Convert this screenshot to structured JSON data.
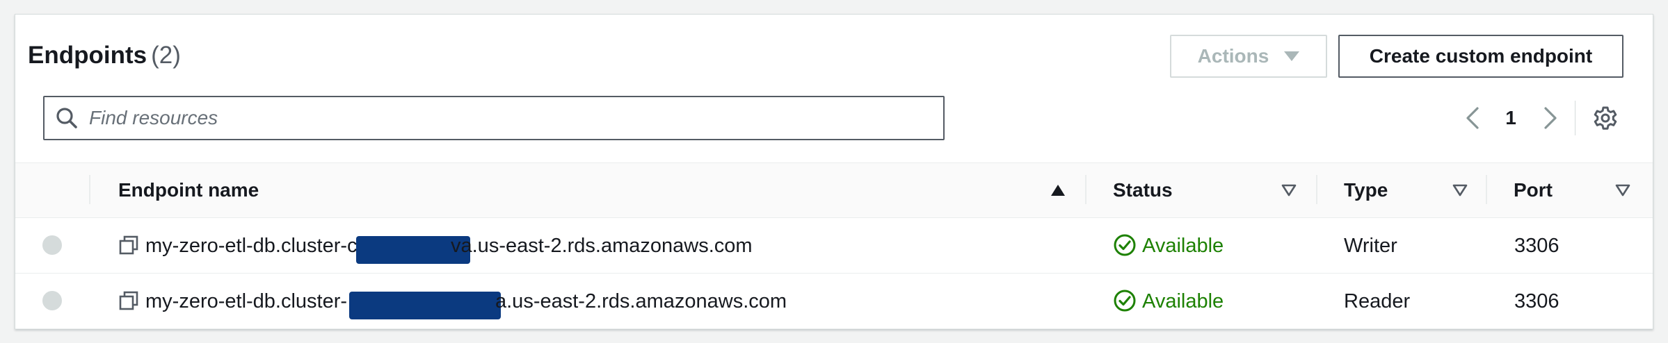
{
  "header": {
    "title": "Endpoints",
    "count": "(2)"
  },
  "toolbar": {
    "actions_label": "Actions",
    "create_label": "Create custom endpoint"
  },
  "search": {
    "placeholder": "Find resources",
    "value": ""
  },
  "pagination": {
    "current_page": "1"
  },
  "table": {
    "columns": [
      {
        "label": "Endpoint name",
        "sort": "ascending"
      },
      {
        "label": "Status",
        "sort": "none"
      },
      {
        "label": "Type",
        "sort": "none"
      },
      {
        "label": "Port",
        "sort": "none"
      }
    ],
    "rows": [
      {
        "name_prefix": "my-zero-etl-db.cluster-c",
        "name_suffix": "va.us-east-2.rds.amazonaws.com",
        "status": "Available",
        "type": "Writer",
        "port": "3306"
      },
      {
        "name_prefix": "my-zero-etl-db.cluster-",
        "name_suffix": "a.us-east-2.rds.amazonaws.com",
        "status": "Available",
        "type": "Reader",
        "port": "3306"
      }
    ]
  },
  "colors": {
    "status_ok": "#1d8102",
    "redaction": "#0b3a80",
    "border_dark": "#545b64"
  },
  "icons": [
    "search-icon",
    "caret-down-icon",
    "chevron-left-icon",
    "chevron-right-icon",
    "gear-icon",
    "sort-ascending-icon",
    "sort-icon",
    "copy-icon",
    "check-circle-icon"
  ]
}
